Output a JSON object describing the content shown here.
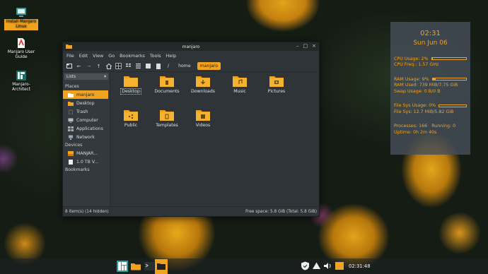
{
  "desktop": {
    "icons": [
      {
        "label": "Install Manjaro Linux",
        "icon": "installer-icon"
      },
      {
        "label": "Manjaro User Guide",
        "icon": "pdf-icon"
      },
      {
        "label": "Manjaro-Architect",
        "icon": "architect-icon"
      }
    ]
  },
  "window": {
    "title": "manjaro",
    "menu": [
      "File",
      "Edit",
      "View",
      "Go",
      "Bookmarks",
      "Tools",
      "Help"
    ],
    "path": {
      "separator": "/",
      "crumbs": [
        "home",
        "manjaro"
      ]
    },
    "sidebar": {
      "selector": "Lists",
      "places_header": "Places",
      "places": [
        "manjaro",
        "Desktop",
        "Trash",
        "Computer",
        "Applications",
        "Network"
      ],
      "devices_header": "Devices",
      "devices": [
        "MANJAR...",
        "1.0 TB V..."
      ],
      "bookmarks_header": "Bookmarks"
    },
    "files": [
      "Desktop",
      "Documents",
      "Downloads",
      "Music",
      "Pictures",
      "Public",
      "Templates",
      "Videos"
    ],
    "status_left": "8 item(s) (14 hidden)",
    "status_right": "Free space: 5.8 GiB (Total: 5.8 GiB)"
  },
  "conky": {
    "time": "02:31",
    "date": "Sun Jun 06",
    "cpu_usage": "CPU Usage: 2%",
    "cpu_usage_pct": 2,
    "cpu_freq": "CPU Freq.: 1.57 GHz",
    "ram_usage": "RAM Usage: 9%",
    "ram_usage_pct": 9,
    "ram_used": "RAM Used: 739 MiB/7.75 GiB",
    "swap_usage": "Swap Usage: 0 B/0 B",
    "fs_usage": "File Sys Usage: 0%",
    "fs_usage_pct": 0,
    "fs_sys": "File Sys: 12.7 MiB/5.82 GiB",
    "processes": "Processes: 166",
    "running": "Running: 0",
    "uptime": "Uptime: 0h 2m 40s"
  },
  "taskbar": {
    "clock": "02:31:48"
  },
  "colors": {
    "accent": "#f0a31e",
    "window_bg": "#2e3437",
    "sidebar_bg": "#33393c"
  }
}
